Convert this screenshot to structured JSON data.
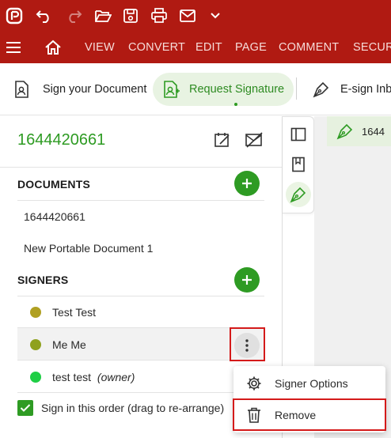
{
  "titlebar": {
    "icons": [
      "app-logo-icon",
      "undo-icon",
      "redo-icon",
      "open-folder-icon",
      "save-icon",
      "print-icon",
      "email-icon",
      "chevron-down-icon"
    ],
    "bg_color": "#b01a12"
  },
  "menu": {
    "items": [
      "VIEW",
      "CONVERT",
      "EDIT",
      "PAGE",
      "COMMENT",
      "SECURE"
    ],
    "icons": [
      "hamburger-icon",
      "home-icon"
    ]
  },
  "toolbar": {
    "sign_document": "Sign your Document",
    "request_signature": "Request Signature",
    "esign_inbox": "E-sign Inbo",
    "accent_color": "#2e9b23"
  },
  "panel": {
    "title": "1644420661",
    "documents_label": "DOCUMENTS",
    "documents": [
      "1644420661",
      "New Portable Document 1"
    ],
    "signers_label": "SIGNERS",
    "signers": [
      {
        "name": "Test Test",
        "suffix": "",
        "color": "#b0a022"
      },
      {
        "name": "Me Me",
        "suffix": "",
        "color": "#8fa11e"
      },
      {
        "name": "test test",
        "suffix": "(owner)",
        "color": "#1fce45"
      }
    ],
    "order_checkbox_label": "Sign in this order (drag to re-arrange)",
    "order_checked": true
  },
  "canvas": {
    "card_text": "1644"
  },
  "context_menu": {
    "signer_options": "Signer Options",
    "remove": "Remove"
  }
}
